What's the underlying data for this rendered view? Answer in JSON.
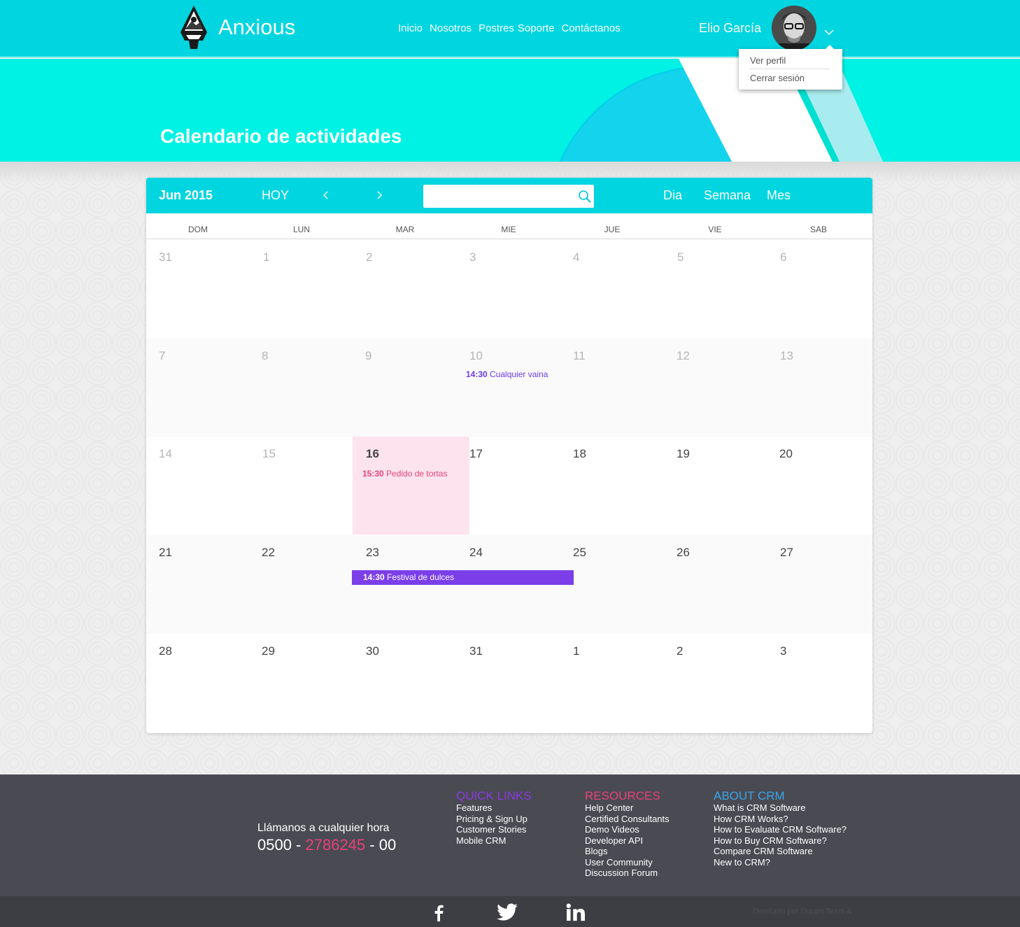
{
  "app": {
    "brand": "Anxious"
  },
  "nav": [
    "Inicio",
    "Nosotros",
    "Postres",
    "Soporte",
    "Contáctanos"
  ],
  "user": {
    "name": "Elio García"
  },
  "user_menu": {
    "view_profile": "Ver perfil",
    "logout": "Cerrar sesión"
  },
  "hero": {
    "title": "Calendario de actividades"
  },
  "calendar": {
    "month_label": "Jun 2015",
    "today_label": "HOY",
    "search": {
      "value": "",
      "placeholder": ""
    },
    "views": {
      "day": "Dia",
      "week": "Semana",
      "month": "Mes"
    },
    "weekdays": [
      "DOM",
      "LUN",
      "MAR",
      "MIE",
      "JUE",
      "VIE",
      "SAB"
    ],
    "weeks": [
      [
        "31",
        "1",
        "2",
        "3",
        "4",
        "5",
        "6"
      ],
      [
        "7",
        "8",
        "9",
        "10",
        "11",
        "12",
        "13"
      ],
      [
        "14",
        "15",
        "16",
        "17",
        "18",
        "19",
        "20"
      ],
      [
        "21",
        "22",
        "23",
        "24",
        "25",
        "26",
        "27"
      ],
      [
        "28",
        "29",
        "30",
        "31",
        "1",
        "2",
        "3"
      ]
    ],
    "events": {
      "cualquier_vaina": {
        "time": "14:30",
        "title": "Cualquier vaina"
      },
      "pedido_tortas": {
        "time": "15:30",
        "title": "Pedido de tortas"
      },
      "festival_dulces": {
        "time": "14:30",
        "title": "Festival de dulces"
      }
    },
    "colors": {
      "accent": "#00d5e0",
      "today_bg": "#fde3ee",
      "event_bar": "#7b3ee8",
      "event_pink": "#e8427a",
      "event_blue": "#6a3cf0"
    }
  },
  "footer": {
    "call_label": "Llámanos a cualquier hora",
    "phone": {
      "prefix": "0500 - ",
      "main": "2786245",
      "suffix": " - 00"
    },
    "columns": [
      {
        "title": "QUICK LINKS",
        "color": "#8a3be0",
        "links": [
          "Features",
          "Pricing & Sign Up",
          "Customer Stories",
          "Mobile CRM"
        ]
      },
      {
        "title": "RESOURCES",
        "color": "#e8427a",
        "links": [
          "Help Center",
          "Certified Consultants",
          "Demo Videos",
          "Developer API",
          "Blogs",
          "User Community",
          "Discussion Forum"
        ]
      },
      {
        "title": "ABOUT CRM",
        "color": "#3aa6e8",
        "links": [
          "What is CRM Software",
          "How CRM Works?",
          "How to Evaluate CRM Software?",
          "How to Buy CRM Software?",
          "Compare CRM Software",
          "New to CRM?"
        ]
      }
    ],
    "social": [
      "facebook-icon",
      "twitter-icon",
      "linkedin-icon"
    ],
    "credit": "Diseñado por Dream Team A"
  }
}
